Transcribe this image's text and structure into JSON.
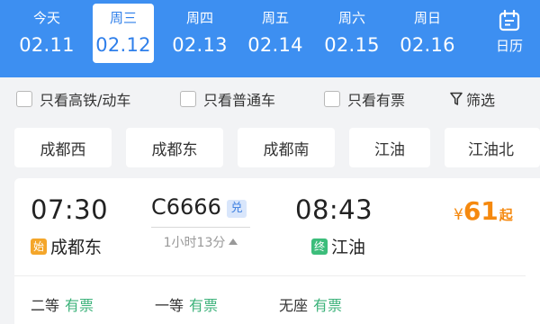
{
  "date_bar": {
    "days": [
      {
        "weekday": "今天",
        "date": "02.11"
      },
      {
        "weekday": "周三",
        "date": "02.12"
      },
      {
        "weekday": "周四",
        "date": "02.13"
      },
      {
        "weekday": "周五",
        "date": "02.14"
      },
      {
        "weekday": "周六",
        "date": "02.15"
      },
      {
        "weekday": "周日",
        "date": "02.16"
      }
    ],
    "selected_index": 1,
    "calendar_label": "日历"
  },
  "filters": {
    "high_speed_only": "只看高铁/动车",
    "regular_only": "只看普通车",
    "available_only": "只看有票",
    "filter_label": "筛选"
  },
  "stations": [
    "成都西",
    "成都东",
    "成都南",
    "江油",
    "江油北"
  ],
  "train": {
    "depart_time": "07:30",
    "arrive_time": "08:43",
    "number": "C6666",
    "exchange_badge": "兑",
    "duration": "1小时13分",
    "origin_tag": "始",
    "origin": "成都东",
    "terminal_tag": "终",
    "destination": "江油",
    "price_currency": "¥",
    "price": "61",
    "price_suffix": "起",
    "seats": [
      {
        "class": "二等",
        "status": "有票"
      },
      {
        "class": "一等",
        "status": "有票"
      },
      {
        "class": "无座",
        "status": "有票"
      }
    ]
  },
  "colors": {
    "header_blue": "#3d8ff1",
    "price_orange": "#f5890f",
    "available_green": "#3cb27a",
    "start_tag": "#f4a62a",
    "end_tag": "#3cbd7b"
  }
}
